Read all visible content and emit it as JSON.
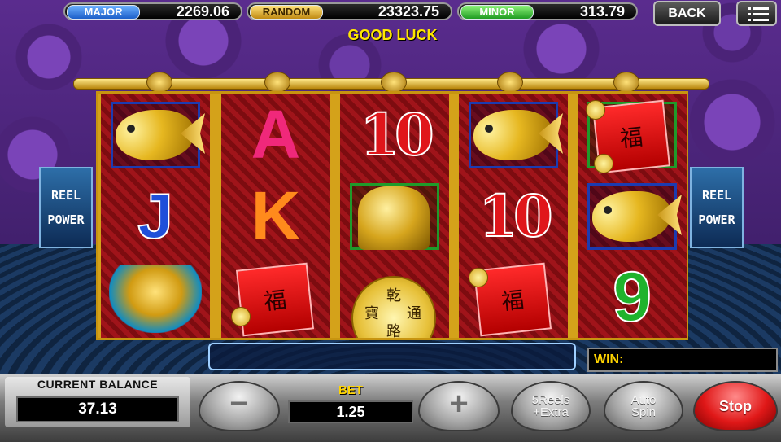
{
  "jackpots": {
    "major": {
      "label": "MAJOR",
      "value": "2269.06"
    },
    "random": {
      "label": "RANDOM",
      "value": "23323.75"
    },
    "minor": {
      "label": "MINOR",
      "value": "313.79"
    }
  },
  "top_buttons": {
    "back": "BACK",
    "menu_icon": "hamburger-menu-icon"
  },
  "message": "GOOD LUCK",
  "side_panels": {
    "line1": "REEL",
    "line2": "POWER"
  },
  "reels": [
    [
      "gold-fish",
      "J",
      "phoenix"
    ],
    [
      "A",
      "K",
      "red-envelope"
    ],
    [
      "10",
      "golden-lion",
      "gold-coin"
    ],
    [
      "gold-fish",
      "10",
      "red-envelope"
    ],
    [
      "red-envelope",
      "gold-fish",
      "9"
    ]
  ],
  "coin_chars": [
    "乾",
    "通",
    "寶",
    "路"
  ],
  "envelope_char": "福",
  "status_bar": "",
  "win": {
    "label": "WIN:",
    "value": ""
  },
  "balance": {
    "label": "CURRENT BALANCE",
    "value": "37.13"
  },
  "bet": {
    "label": "BET",
    "value": "1.25"
  },
  "controls": {
    "minus": "−",
    "plus": "+",
    "reels_line1": "5Reels",
    "reels_line2": "+Extra",
    "auto_line1": "Auto",
    "auto_line2": "Spin",
    "stop": "Stop"
  },
  "colors": {
    "major": "#1c5fc9",
    "random": "#c08a12",
    "minor": "#1f9c21",
    "accent": "#ffd400",
    "stop": "#e01818"
  }
}
